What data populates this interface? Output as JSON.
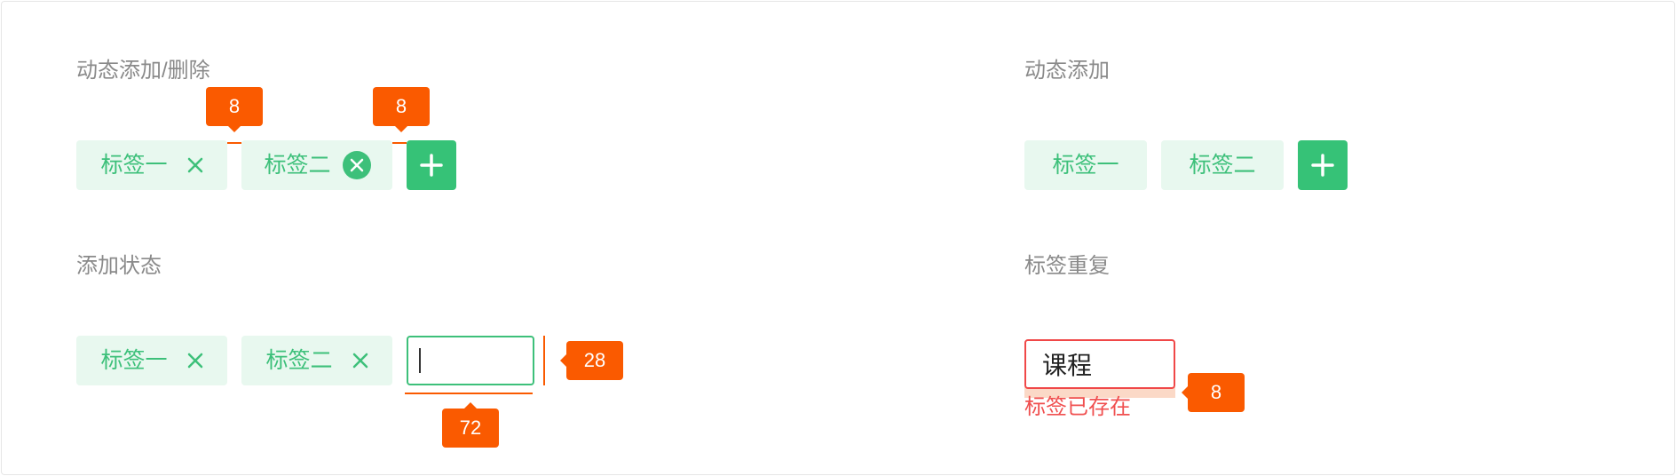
{
  "sections": {
    "dynamic_add_delete": {
      "title": "动态添加/删除",
      "tags": [
        {
          "label": "标签一",
          "close_icon": "close-icon"
        },
        {
          "label": "标签二",
          "close_icon": "close-circle-icon"
        }
      ],
      "spacing_annotations": [
        "8",
        "8"
      ]
    },
    "dynamic_add": {
      "title": "动态添加",
      "tags": [
        {
          "label": "标签一"
        },
        {
          "label": "标签二"
        }
      ]
    },
    "add_state": {
      "title": "添加状态",
      "tags": [
        {
          "label": "标签一",
          "close_icon": "close-icon"
        },
        {
          "label": "标签二",
          "close_icon": "close-icon"
        }
      ],
      "input_value": "",
      "height_annotation": "28",
      "width_annotation": "72"
    },
    "duplicate_tag": {
      "title": "标签重复",
      "input_value": "课程",
      "error_message": "标签已存在",
      "spacing_annotation": "8"
    }
  },
  "colors": {
    "tag_text": "#3dc07a",
    "tag_bg": "#e8f8ef",
    "add_button": "#36c277",
    "annotation": "#fa5a00",
    "error": "#f04848"
  },
  "icons": {
    "add": "plus-icon",
    "remove": "close-icon",
    "remove_hover": "close-circle-icon"
  }
}
